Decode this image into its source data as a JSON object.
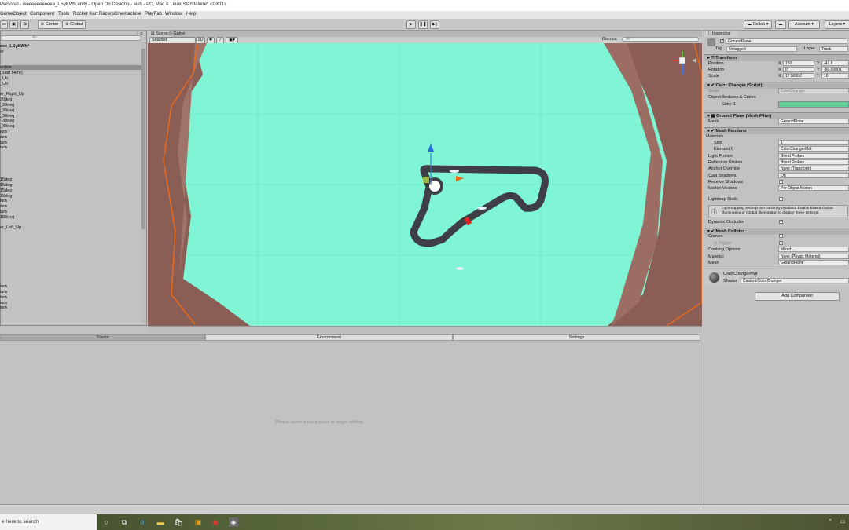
{
  "window": {
    "title": "Personal - weeeeeeeeeee_LSyKWh.unity - Open On Desktop - lesh - PC, Mac & Linux Standalone* <DX11>"
  },
  "menu": [
    "GameObject",
    "Component",
    "Tools",
    "Rocket Kart Racers",
    "Cinemachine",
    "PlayFab",
    "Window",
    "Help"
  ],
  "toolbar": {
    "center": "Center",
    "global": "Global",
    "collab": "Collab",
    "account": "Account",
    "layers": "Layers"
  },
  "hierarchy": {
    "search_placeholder": "All",
    "scene_name": "eee_LSyKWh*",
    "rows": [
      "er",
      "",
      "",
      "ection",
      "(Start Here)",
      "_Up",
      "_Up",
      "",
      "er_Right_Up",
      "30deg",
      "_30deg",
      "_30deg",
      "_30deg",
      "_30deg",
      "_30deg",
      "ium",
      "ium",
      "ium",
      "ium",
      "",
      "",
      "",
      "",
      "",
      "15deg",
      "15deg",
      "15deg",
      "15deg",
      "ium",
      "ium",
      "ium",
      "180deg",
      "",
      "er_Left_Up",
      "",
      "",
      "",
      "",
      "",
      "",
      "",
      "",
      "",
      "",
      "ium",
      "ium",
      "ium",
      "ium",
      "ium"
    ]
  },
  "scene": {
    "tab_scene": "Scene",
    "tab_game": "Game",
    "shading": "Shaded",
    "mode_2d": "2D",
    "gizmos": "Gizmos",
    "search_placeholder": "All"
  },
  "bottom_tabs": [
    "Tracks",
    "Environment",
    "Settings"
  ],
  "bottom_placeholder": "Please select a track piece to begin editing",
  "inspector": {
    "tab": "Inspector",
    "object_name": "GroundPlane",
    "tag_label": "Tag",
    "tag_value": "Untagged",
    "layer_label": "Layer",
    "layer_value": "Track",
    "transform": {
      "title": "Transform",
      "position_label": "Position",
      "position": {
        "x": "160",
        "y": "-41.8"
      },
      "rotation_label": "Rotation",
      "rotation": {
        "x": "0",
        "y": "-90.00001"
      },
      "scale_label": "Scale",
      "scale": {
        "x": "17.50002",
        "y": "10"
      }
    },
    "color_changer": {
      "title": "Color Changer (Script)",
      "script_label": "Script",
      "script_value": "ColorChanger",
      "textures_label": "Object Textures & Colors",
      "color_label": "Color 1",
      "color_value": "#5fcf95"
    },
    "mesh_filter": {
      "title": "Ground Plane (Mesh Filter)",
      "mesh_label": "Mesh",
      "mesh_value": "GroundPlane"
    },
    "mesh_renderer": {
      "title": "Mesh Renderer",
      "materials_label": "Materials",
      "size_label": "Size",
      "size_value": "1",
      "element_label": "Element 0",
      "element_value": "ColorChangerMat",
      "light_probes_label": "Light Probes",
      "light_probes_value": "Blend Probes",
      "reflection_label": "Reflection Probes",
      "reflection_value": "Blend Probes",
      "anchor_label": "Anchor Override",
      "anchor_value": "None (Transform)",
      "cast_label": "Cast Shadows",
      "cast_value": "On",
      "receive_label": "Receive Shadows",
      "motion_label": "Motion Vectors",
      "motion_value": "Per Object Motion",
      "lightmap_label": "Lightmap Static",
      "info": "Lightmapping settings are currently disabled. Enable Baked Global Illumination or Global Illumination to display these settings.",
      "occluded_label": "Dynamic Occluded"
    },
    "mesh_collider": {
      "title": "Mesh Collider",
      "convex_label": "Convex",
      "trigger_label": "Is Trigger",
      "cooking_label": "Cooking Options",
      "cooking_value": "Mixed ...",
      "material_label": "Material",
      "material_value": "None (Physic Material)",
      "mesh_label": "Mesh",
      "mesh_value": "GroundPlane"
    },
    "material": {
      "name": "ColorChangerMat",
      "shader_label": "Shader",
      "shader_value": "Custom/ColorChanger"
    },
    "add_component": "Add Component"
  },
  "taskbar": {
    "search_placeholder": "e here to search"
  }
}
